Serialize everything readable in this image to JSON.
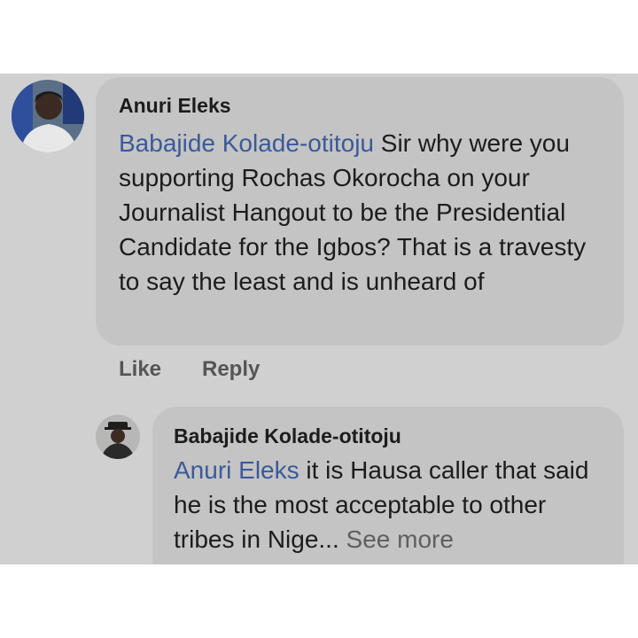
{
  "comment": {
    "author": "Anuri Eleks",
    "mention": "Babajide Kolade-otitoju",
    "text": " Sir why were you supporting Rochas Okorocha on your Journalist Hangout to be the Presidential Candidate for the Igbos? That is a travesty to say the least and is unheard of"
  },
  "actions": {
    "like": "Like",
    "reply": "Reply"
  },
  "reply": {
    "author": "Babajide Kolade-otitoju",
    "mention": "Anuri Eleks",
    "text": " it is Hausa caller that said he is the most acceptable to other tribes in Nige...",
    "see_more": "See more"
  },
  "colors": {
    "mention": "#3a5a9b",
    "bubble": "#c4c4c4",
    "background": "#d0d0d0"
  }
}
